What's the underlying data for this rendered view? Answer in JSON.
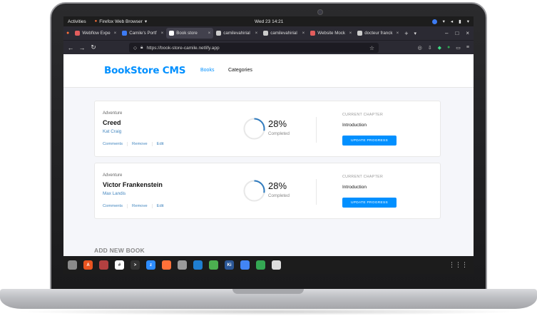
{
  "topbar": {
    "activities": "Activities",
    "app_name": "Firefox Web Browser",
    "clock": "Wed 23  14:21"
  },
  "tabs": [
    {
      "label": "Webflow Expe",
      "color": "#e35d5d"
    },
    {
      "label": "Camile's Portf",
      "color": "#3d7bf3"
    },
    {
      "label": "Book store",
      "color": "#ffffff",
      "active": true
    },
    {
      "label": "camilevahirial",
      "color": "#cccccc"
    },
    {
      "label": "camilevahirial",
      "color": "#cccccc"
    },
    {
      "label": "Website Mock",
      "color": "#e35d5d"
    },
    {
      "label": "docteur franck",
      "color": "#cccccc"
    }
  ],
  "window_controls": {
    "minimize": "–",
    "maximize": "□",
    "close": "×"
  },
  "browser": {
    "url": "https://book-store-camile.netlify.app"
  },
  "app": {
    "brand": "BookStore CMS",
    "nav": [
      {
        "label": "Books",
        "active": true
      },
      {
        "label": "Categories"
      }
    ],
    "books": [
      {
        "genre": "Adventure",
        "title": "Creed",
        "author": "Kat Craig",
        "actions": [
          "Comments",
          "Remove",
          "Edit"
        ],
        "progress_percent": 28,
        "percent_text": "28%",
        "completed_label": "Completed",
        "chapter_label": "CURRENT CHAPTER",
        "chapter_value": "Introduction",
        "button_label": "UPDATE PROGRESS"
      },
      {
        "genre": "Adventure",
        "title": "Victor Frankenstein",
        "author": "Max Landis",
        "actions": [
          "Comments",
          "Remove",
          "Edit"
        ],
        "progress_percent": 28,
        "percent_text": "28%",
        "completed_label": "Completed",
        "chapter_label": "CURRENT CHAPTER",
        "chapter_value": "Introduction",
        "button_label": "UPDATE PROGRESS"
      }
    ],
    "add_new_heading": "ADD NEW BOOK"
  },
  "colors": {
    "accent": "#0290ff",
    "link": "#4386bf",
    "page_bg": "#f5f6fa"
  },
  "dock": [
    {
      "name": "files-icon",
      "color": "#8a8a8a",
      "glyph": ""
    },
    {
      "name": "software-icon",
      "color": "#e95420",
      "glyph": "A"
    },
    {
      "name": "recorder-icon",
      "color": "#b34040",
      "glyph": ""
    },
    {
      "name": "slack-icon",
      "color": "#ffffff",
      "glyph": "#"
    },
    {
      "name": "terminal-icon",
      "color": "#333333",
      "glyph": ">"
    },
    {
      "name": "zoom-icon",
      "color": "#2d8cff",
      "glyph": "z"
    },
    {
      "name": "firefox-icon",
      "color": "#ff7139",
      "glyph": ""
    },
    {
      "name": "search-tool-icon",
      "color": "#9a9a9a",
      "glyph": ""
    },
    {
      "name": "vscode-icon",
      "color": "#1f7ed0",
      "glyph": ""
    },
    {
      "name": "chrome-icon",
      "color": "#4caf50",
      "glyph": ""
    },
    {
      "name": "krita-icon",
      "color": "#2b5797",
      "glyph": "Ki"
    },
    {
      "name": "docs-icon",
      "color": "#4285f4",
      "glyph": ""
    },
    {
      "name": "sheets-icon",
      "color": "#34a853",
      "glyph": ""
    },
    {
      "name": "inkscape-icon",
      "color": "#dddddd",
      "glyph": ""
    }
  ]
}
